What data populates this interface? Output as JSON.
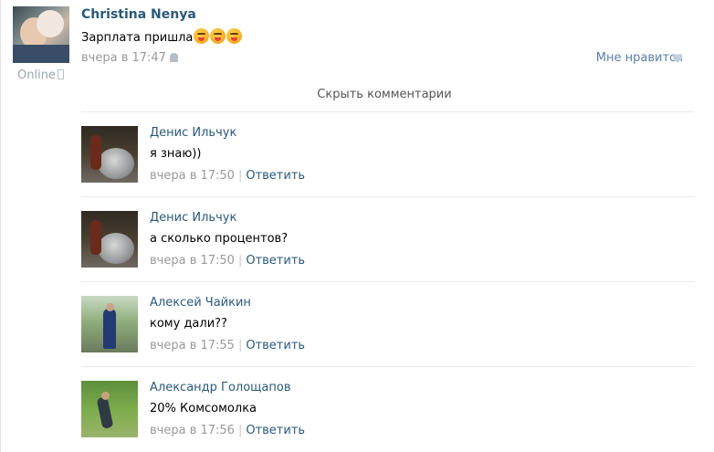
{
  "post": {
    "author": "Christina Nenya",
    "text": "Зарплата пришла",
    "emoji_count": 3,
    "emoji_icon": "tongue-squint-emoji",
    "time": "вчера в 17:47",
    "online": "Online",
    "like_label": "Мне нравится"
  },
  "hide_comments": "Скрыть комментарии",
  "comments": [
    {
      "name": "Денис Ильчук",
      "text": "я знаю))",
      "time": "вчера в 17:50",
      "reply": "Ответить"
    },
    {
      "name": "Денис Ильчук",
      "text": "а сколько процентов?",
      "time": "вчера в 17:50",
      "reply": "Ответить"
    },
    {
      "name": "Алексей Чайкин",
      "text": "кому дали??",
      "time": "вчера в 17:55",
      "reply": "Ответить"
    },
    {
      "name": "Александр Голощапов",
      "text": "20% Комсомолка",
      "time": "вчера в 17:56",
      "reply": "Ответить"
    }
  ],
  "colors": {
    "link": "#2b587a",
    "meta": "#999999",
    "like": "#5b7fa6"
  }
}
